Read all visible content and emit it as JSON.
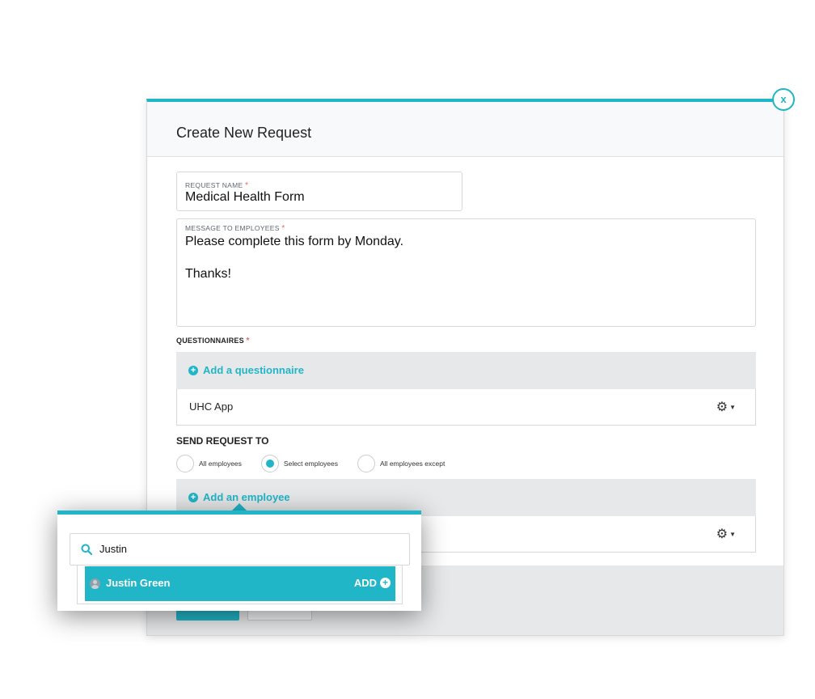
{
  "modal": {
    "title": "Create New Request",
    "close_label": "x"
  },
  "request_name": {
    "label": "REQUEST NAME",
    "required_mark": "*",
    "value": "Medical Health Form"
  },
  "message": {
    "label": "MESSAGE TO EMPLOYEES",
    "required_mark": "*",
    "value": "Please complete this form by Monday.\n\nThanks!"
  },
  "questionnaires": {
    "label": "QUESTIONNAIRES",
    "required_mark": "*",
    "add_label": "Add a questionnaire",
    "items": [
      {
        "name": "UHC App",
        "icon": "gear-icon"
      }
    ]
  },
  "send_to": {
    "label": "SEND REQUEST TO",
    "options": [
      {
        "label": "All employees",
        "selected": false
      },
      {
        "label": "Select employees",
        "selected": true
      },
      {
        "label": "All employees except",
        "selected": false
      }
    ],
    "add_label": "Add an employee"
  },
  "employee_picker": {
    "search_value": "Justin",
    "results": [
      {
        "name": "Justin Green",
        "action": "ADD"
      }
    ]
  },
  "colors": {
    "accent": "#21b5c8",
    "required": "#e8686a",
    "panel": "#e6e8ea"
  }
}
